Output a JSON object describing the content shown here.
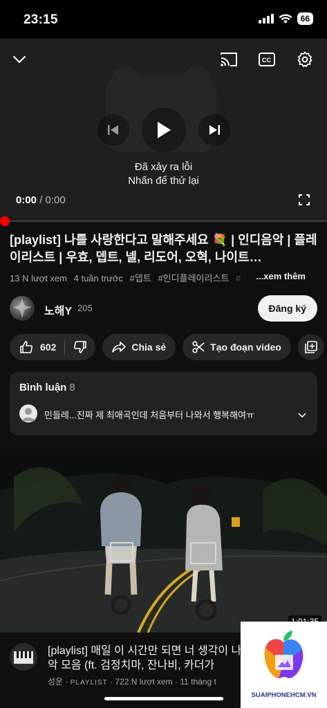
{
  "status_bar": {
    "time": "23:15",
    "battery": "66"
  },
  "player": {
    "error_line1": "Đã xảy ra lỗi",
    "error_line2": "Nhấn để thử lại",
    "current_time": "0:00",
    "separator": " / ",
    "duration": "0:00",
    "progress": 0
  },
  "video": {
    "title": "[playlist] 나를 사랑한다고 말해주세요 💐 | 인디음악 | 플레이리스트 | 우효, 뎁트, 넬,  리도어, 오혁, 나이트…",
    "views": "13 N lượt xem",
    "age": "4 tuần trước",
    "tags": [
      "#뎁트",
      "#인디플레이리스트",
      "#"
    ],
    "more": "...xem thêm"
  },
  "channel": {
    "name": "노해Y",
    "subscribers": "205",
    "subscribe_label": "Đăng ký"
  },
  "actions": {
    "likes": "602",
    "share": "Chia sẻ",
    "clip": "Tạo đoạn video"
  },
  "comments": {
    "title": "Bình luận",
    "count": "8",
    "top_comment": "민들레...진짜 제 최애곡인데 처음부터 나와서 행복해여ㅠ"
  },
  "next_video": {
    "duration": "1:01:35",
    "title": "[playlist] 매일 이 시간만 되면 너 생각이 나 인디 음악 모음 (ft. 검정치마, 잔나비, 카더가",
    "channel": "성운",
    "badge": "PLAYLIST",
    "views": "722 N lượt xem",
    "age": "11 tháng t"
  },
  "watermark": {
    "text": "SUAIPHONEHCM.VN"
  },
  "colors": {
    "accent": "#ff0000",
    "background": "#0f0f0f",
    "pill": "#272727"
  }
}
